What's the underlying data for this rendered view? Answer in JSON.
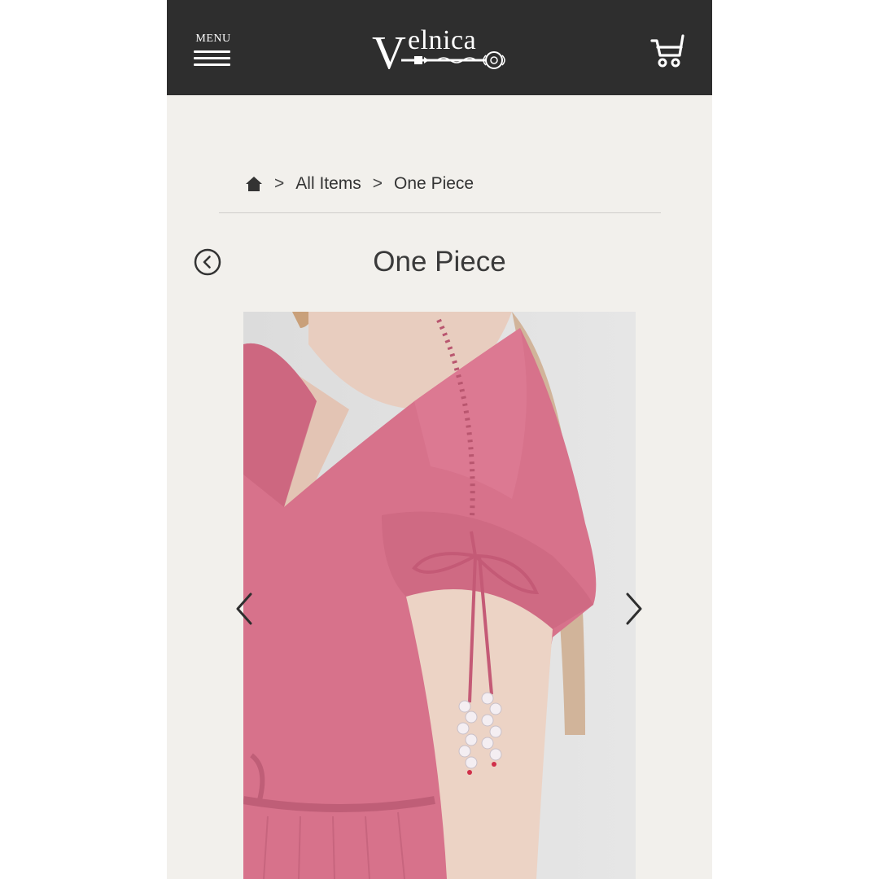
{
  "header": {
    "menu_label": "MENU",
    "logo_text": "elnica",
    "logo_initial": "V"
  },
  "breadcrumb": {
    "items": [
      {
        "label": "All Items"
      },
      {
        "label": "One Piece"
      }
    ],
    "separator": ">"
  },
  "page": {
    "title": "One Piece"
  },
  "icons": {
    "menu": "hamburger-icon",
    "cart": "cart-icon",
    "home": "home-icon",
    "back": "circle-chevron-left-icon",
    "prev": "chevron-left-icon",
    "next": "chevron-right-icon"
  },
  "colors": {
    "header_bg": "#2e2e2e",
    "page_bg": "#f2f0ec",
    "dress_pink": "#d7728b"
  }
}
